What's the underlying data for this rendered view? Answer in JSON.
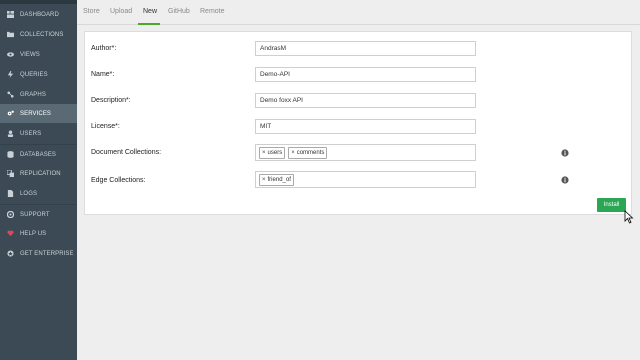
{
  "sidebar": {
    "items": [
      {
        "label": "DASHBOARD",
        "icon": "dashboard-icon"
      },
      {
        "label": "COLLECTIONS",
        "icon": "folder-icon"
      },
      {
        "label": "VIEWS",
        "icon": "eye-icon"
      },
      {
        "label": "QUERIES",
        "icon": "bolt-icon"
      },
      {
        "label": "GRAPHS",
        "icon": "graph-icon"
      },
      {
        "label": "SERVICES",
        "icon": "cogs-icon",
        "active": true
      },
      {
        "label": "USERS",
        "icon": "users-icon"
      },
      {
        "label": "DATABASES",
        "icon": "database-icon"
      },
      {
        "label": "REPLICATION",
        "icon": "replication-icon"
      },
      {
        "label": "LOGS",
        "icon": "file-icon"
      },
      {
        "label": "SUPPORT",
        "icon": "support-icon"
      },
      {
        "label": "HELP US",
        "icon": "heart-icon"
      },
      {
        "label": "GET ENTERPRISE",
        "icon": "enterprise-icon"
      }
    ]
  },
  "tabs": [
    "Store",
    "Upload",
    "New",
    "GitHub",
    "Remote"
  ],
  "active_tab": "New",
  "form": {
    "author_label": "Author*:",
    "author_value": "AndrasM",
    "name_label": "Name*:",
    "name_value": "Demo-API",
    "description_label": "Description*:",
    "description_value": "Demo foxx API",
    "license_label": "License*:",
    "license_value": "MIT",
    "doc_collections_label": "Document Collections:",
    "doc_collections": [
      "users",
      "comments"
    ],
    "edge_collections_label": "Edge Collections:",
    "edge_collections": [
      "friend_of"
    ],
    "tag_remove_glyph": "×"
  },
  "install_label": "Install",
  "colors": {
    "sidebar_bg": "#3b4a54",
    "active_item": "#5a6a74",
    "accent_green": "#2aa655",
    "tab_underline": "#4ea82a",
    "heart": "#e5435d"
  }
}
